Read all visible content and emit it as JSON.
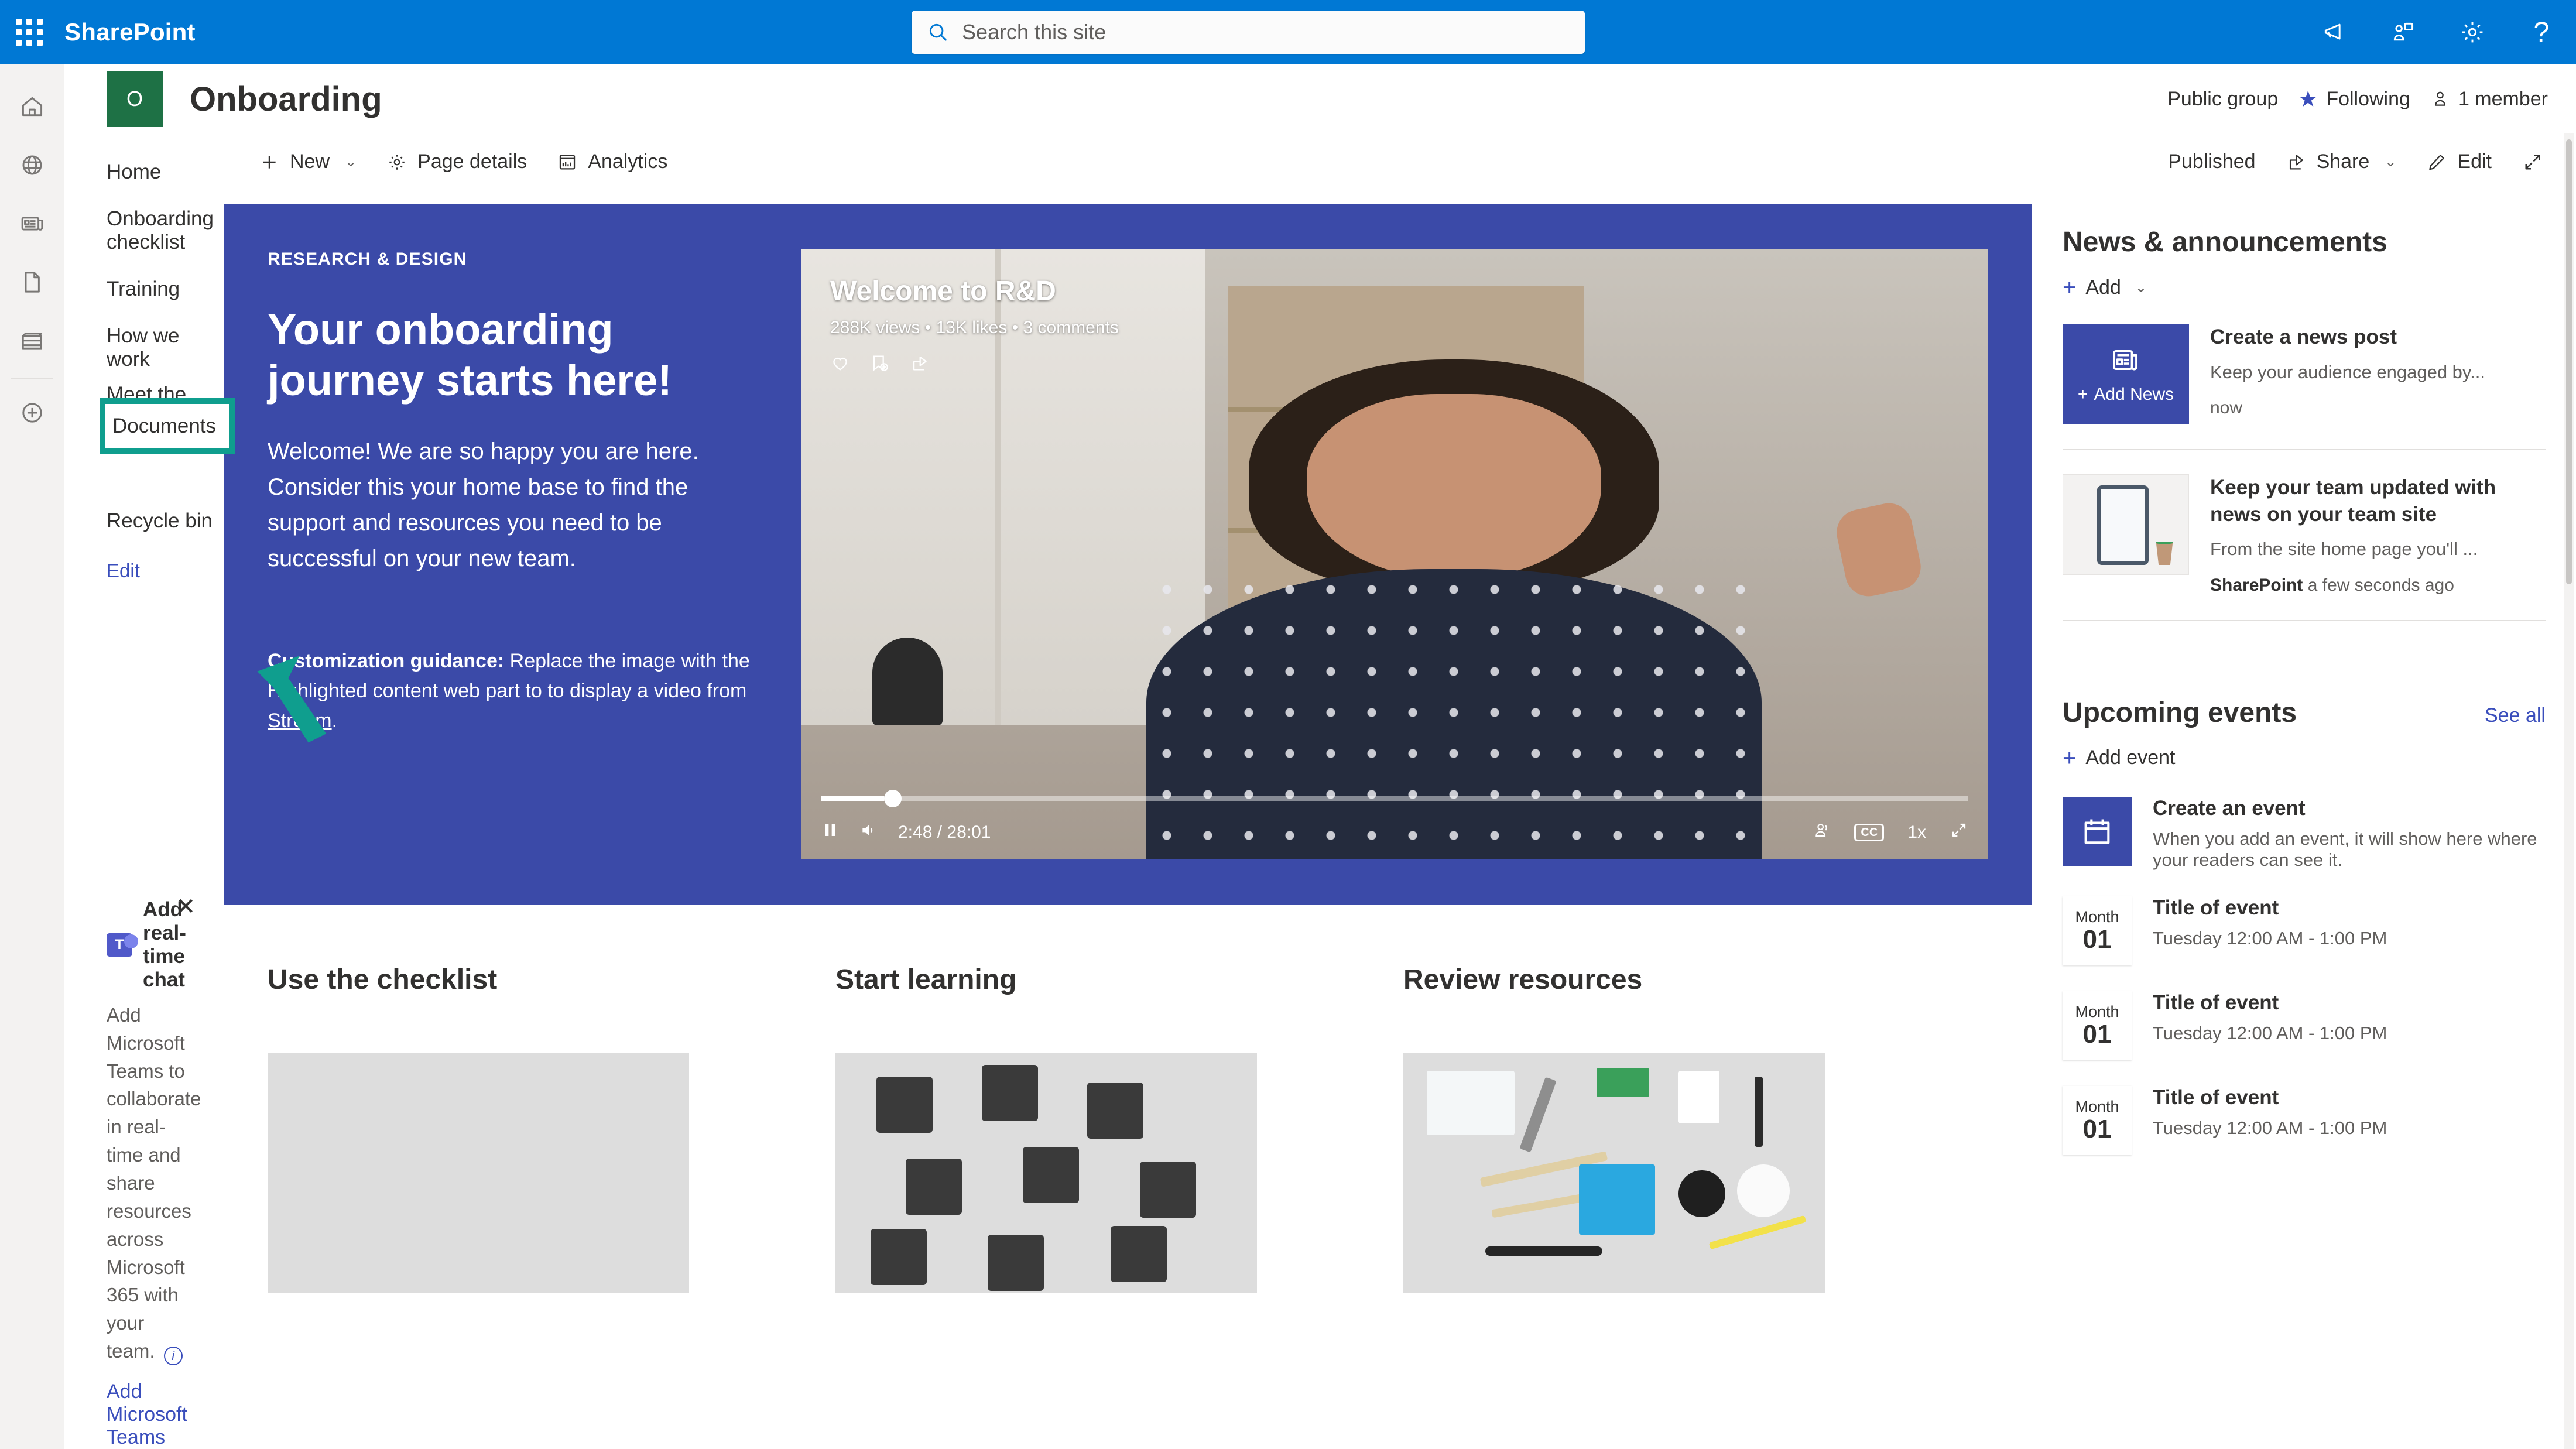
{
  "suite": {
    "brand": "SharePoint",
    "search_placeholder": "Search this site",
    "icons": [
      "waffle-icon",
      "megaphone-icon",
      "feedback-icon",
      "gear-icon",
      "help-icon"
    ]
  },
  "rail": {
    "items": [
      {
        "icon": "home-icon",
        "name": "home"
      },
      {
        "icon": "globe-icon",
        "name": "my-sites"
      },
      {
        "icon": "news-icon",
        "name": "news"
      },
      {
        "icon": "page-icon",
        "name": "files"
      },
      {
        "icon": "lists-icon",
        "name": "lists"
      },
      {
        "icon": "create-icon",
        "name": "create"
      }
    ]
  },
  "site": {
    "logo_letter": "O",
    "title": "Onboarding",
    "privacy": "Public group",
    "following": "Following",
    "members": "1 member"
  },
  "commandbar": {
    "new_label": "New",
    "page_details_label": "Page details",
    "analytics_label": "Analytics",
    "published_label": "Published",
    "share_label": "Share",
    "edit_label": "Edit",
    "expand_name": "full-screen-icon"
  },
  "leftnav": {
    "items": [
      {
        "label": "Home"
      },
      {
        "label": "Onboarding checklist"
      },
      {
        "label": "Training"
      },
      {
        "label": "How we work"
      },
      {
        "label": "Meet the team"
      },
      {
        "label": "Documents"
      },
      {
        "label": "Recycle bin"
      }
    ],
    "highlighted": "Documents",
    "edit_label": "Edit",
    "highlight_color": "#0f9e8e"
  },
  "teams_callout": {
    "title": "Add real-time chat",
    "body": "Add Microsoft Teams to collaborate in real-time and share resources across Microsoft 365 with your team.",
    "link": "Add Microsoft Teams"
  },
  "hero": {
    "eyebrow": "RESEARCH & DESIGN",
    "title": "Your onboarding journey starts here!",
    "description": "Welcome! We are so happy you are here. Consider this your home base to find the support and resources you need to be successful on your new team.",
    "note_bold": "Customization guidance:",
    "note_text": " Replace the image with the Highlighted content web part to to display a video from ",
    "note_link": "Stream",
    "note_end": ".",
    "bg_color": "#3b4aa8"
  },
  "video": {
    "title": "Welcome to R&D",
    "stats": "288K views • 13K likes • 3 comments",
    "actions": [
      "like-icon",
      "save-icon",
      "share-icon"
    ],
    "time": "2:48 / 28:01",
    "speed": "1x",
    "cc": "CC",
    "progress_percent": 5.5
  },
  "cards": [
    {
      "heading": "Use the checklist",
      "image": "sticky-notes-photo"
    },
    {
      "heading": "Start learning",
      "image": "classroom-chairs-photo"
    },
    {
      "heading": "Review resources",
      "image": "desk-supplies-photo"
    }
  ],
  "news": {
    "title": "News & announcements",
    "add_label": "Add",
    "items": [
      {
        "tile": "Add News",
        "heading": "Create a news post",
        "subtitle": "Keep your audience engaged by...",
        "meta_source": "",
        "meta_time": "now"
      },
      {
        "tile": "",
        "heading": "Keep your team updated with news on your team site",
        "subtitle": "From the site home page you'll ...",
        "meta_source": "SharePoint",
        "meta_time": "a few seconds ago"
      }
    ]
  },
  "events": {
    "title": "Upcoming events",
    "see_all": "See all",
    "add_label": "Add event",
    "create": {
      "heading": "Create an event",
      "subtitle": "When you add an event, it will show here where your readers can see it."
    },
    "items": [
      {
        "month": "Month",
        "day": "01",
        "title": "Title of event",
        "time": "Tuesday 12:00 AM - 1:00 PM"
      },
      {
        "month": "Month",
        "day": "01",
        "title": "Title of event",
        "time": "Tuesday 12:00 AM - 1:00 PM"
      },
      {
        "month": "Month",
        "day": "01",
        "title": "Title of event",
        "time": "Tuesday 12:00 AM - 1:00 PM"
      }
    ]
  },
  "colors": {
    "suite_blue": "#0078d4",
    "site_logo_green": "#1e7145",
    "hero_purple": "#3b4aa8",
    "link_purple": "#3a4ebc",
    "highlight_teal": "#0f9e8e"
  }
}
